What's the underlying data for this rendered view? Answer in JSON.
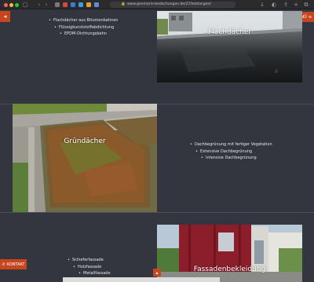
{
  "browser": {
    "url": "www.genmarin-bedachungen.de/27/leistungen/"
  },
  "nav": {
    "back_icon": "chevron-left-icon",
    "menu_label": "MENÜ",
    "menu_icon": "hamburger-icon",
    "kontakt_label": "KONTAKT",
    "kontakt_icon": "phone-icon",
    "top_icon": "chevron-up-icon"
  },
  "sections": {
    "flachdaecher": {
      "label": "Flachdächer",
      "items": [
        "Flachdächer aus Bitumenbahnen",
        "Flüssigkunststoffabdichtung",
        "EPDM-Dichtungsbahn"
      ]
    },
    "gruendaecher": {
      "label": "Gründächer",
      "items": [
        "Dachbegrünung mit fertiger Vegetation",
        "Extensive Dachbegrünung",
        "Intensive Dachbegrünung"
      ]
    },
    "fassaden": {
      "label": "Fassadenbekleidung",
      "items": [
        "Schieferfassade",
        "Holzfassade",
        "Metallfassade"
      ]
    }
  },
  "colors": {
    "accent": "#c8461e",
    "background": "#33353f"
  }
}
